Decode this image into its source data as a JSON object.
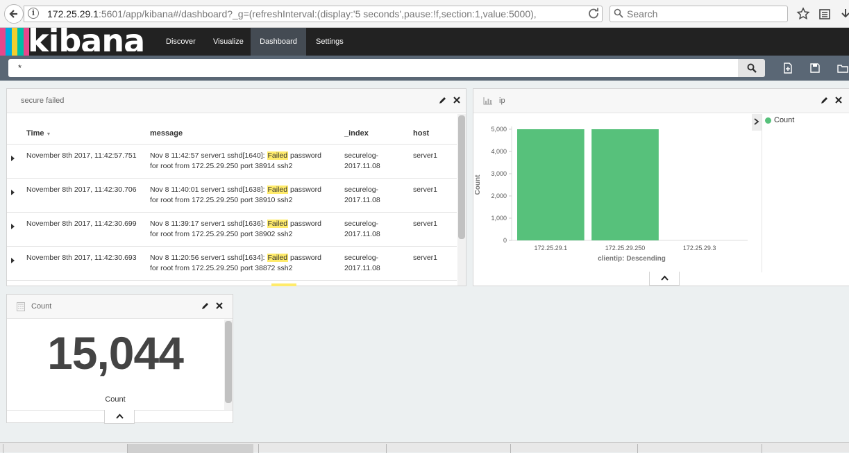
{
  "browser": {
    "url_host": "172.25.29.1",
    "url_rest": ":5601/app/kibana#/dashboard?_g=(refreshInterval:(display:'5 seconds',pause:!f,section:1,value:5000),",
    "search_placeholder": "Search"
  },
  "nav": {
    "logo": "kibana",
    "tabs": [
      {
        "label": "Discover"
      },
      {
        "label": "Visualize"
      },
      {
        "label": "Dashboard",
        "active": true
      },
      {
        "label": "Settings"
      }
    ]
  },
  "query": {
    "value": "*"
  },
  "panels": {
    "search": {
      "title": "secure failed",
      "columns": [
        "Time",
        "message",
        "_index",
        "host"
      ],
      "rows": [
        {
          "time": "November 8th 2017, 11:42:57.751",
          "msg_pre": "Nov  8 11:42:57 server1 sshd[1640]:",
          "hit": "Failed",
          "msg_post": "password",
          "msg_line2": "for root from 172.25.29.250 port 38914 ssh2",
          "index_1": "securelog-",
          "index_2": "2017.11.08",
          "host": "server1"
        },
        {
          "time": "November 8th 2017, 11:42:30.706",
          "msg_pre": "Nov  8 11:40:01 server1 sshd[1638]:",
          "hit": "Failed",
          "msg_post": "password",
          "msg_line2": "for root from 172.25.29.250 port 38910 ssh2",
          "index_1": "securelog-",
          "index_2": "2017.11.08",
          "host": "server1"
        },
        {
          "time": "November 8th 2017, 11:42:30.699",
          "msg_pre": "Nov  8 11:39:17 server1 sshd[1636]:",
          "hit": "Failed",
          "msg_post": "password",
          "msg_line2": "for root from 172.25.29.250 port 38902 ssh2",
          "index_1": "securelog-",
          "index_2": "2017.11.08",
          "host": "server1"
        },
        {
          "time": "November 8th 2017, 11:42:30.693",
          "msg_pre": "Nov  8 11:20:56 server1 sshd[1634]:",
          "hit": "Failed",
          "msg_post": "password",
          "msg_line2": "for root from 172.25.29.250 port 38872 ssh2",
          "index_1": "securelog-",
          "index_2": "2017.11.08",
          "host": "server1"
        }
      ]
    },
    "ip": {
      "title": "ip"
    },
    "metric": {
      "title": "Count",
      "value": "15,044",
      "label": "Count"
    }
  },
  "chart_data": {
    "type": "bar",
    "categories": [
      "172.25.29.1",
      "172.25.29.250",
      "172.25.29.3"
    ],
    "series": [
      {
        "name": "Count",
        "values": [
          5000,
          5000,
          0
        ]
      }
    ],
    "xlabel": "clientip: Descending",
    "ylabel": "Count",
    "ylim": [
      0,
      5000
    ],
    "yticks": [
      "0",
      "1,000",
      "2,000",
      "3,000",
      "4,000",
      "5,000"
    ],
    "ytick_values": [
      0,
      1000,
      2000,
      3000,
      4000,
      5000
    ],
    "legend": "right",
    "color": "#57c17b"
  },
  "colors": {
    "bar": "#57c17b",
    "highlight": "#ffeb6b",
    "nav_bg": "#222222",
    "query_bg": "#5a6775"
  }
}
